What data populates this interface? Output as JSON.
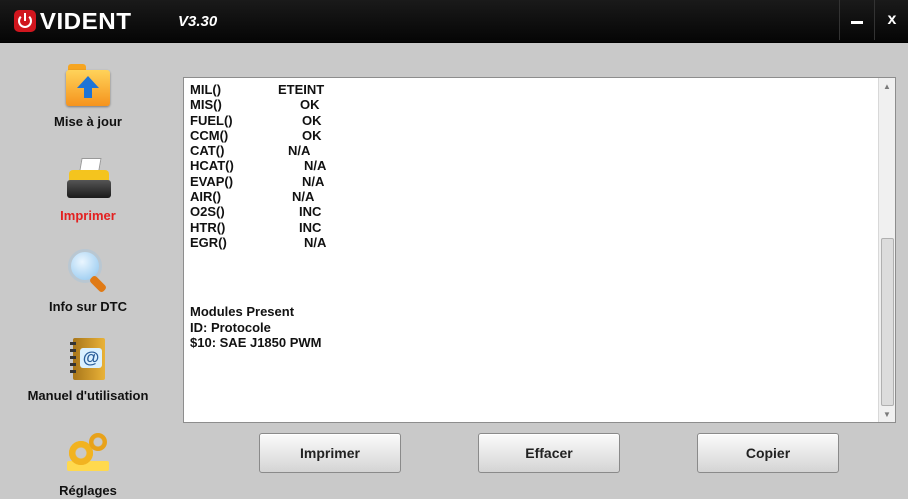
{
  "app": {
    "logo_text": "VIDENT",
    "version": "V3.30"
  },
  "window_controls": {
    "minimize": "—",
    "close": "x"
  },
  "sidebar": {
    "items": [
      {
        "label": "Mise à jour",
        "icon": "folder-upload-icon",
        "active": false
      },
      {
        "label": "Imprimer",
        "icon": "printer-icon",
        "active": true
      },
      {
        "label": "Info sur DTC",
        "icon": "magnifier-icon",
        "active": false
      },
      {
        "label": "Manuel d'utilisation",
        "icon": "address-book-icon",
        "active": false
      },
      {
        "label": "Réglages",
        "icon": "gears-icon",
        "active": false
      }
    ]
  },
  "report": {
    "monitors": [
      {
        "name": "MIL()",
        "status": "ETEINT"
      },
      {
        "name": "MIS()",
        "status": "OK"
      },
      {
        "name": "FUEL()",
        "status": "OK"
      },
      {
        "name": "CCM()",
        "status": "OK"
      },
      {
        "name": "CAT()",
        "status": "N/A"
      },
      {
        "name": "HCAT()",
        "status": "N/A"
      },
      {
        "name": "EVAP()",
        "status": "N/A"
      },
      {
        "name": "AIR()",
        "status": "N/A"
      },
      {
        "name": "O2S()",
        "status": "INC"
      },
      {
        "name": "HTR()",
        "status": "INC"
      },
      {
        "name": "EGR()",
        "status": "N/A"
      }
    ],
    "modules_title": "Modules Present",
    "modules_header": "ID: Protocole",
    "modules_line": "$10: SAE J1850 PWM"
  },
  "buttons": {
    "print": "Imprimer",
    "clear": "Effacer",
    "copy": "Copier"
  },
  "colors": {
    "active_label": "#e32020",
    "titlebar": "#0a0a0a",
    "brand": "#d0161e"
  }
}
